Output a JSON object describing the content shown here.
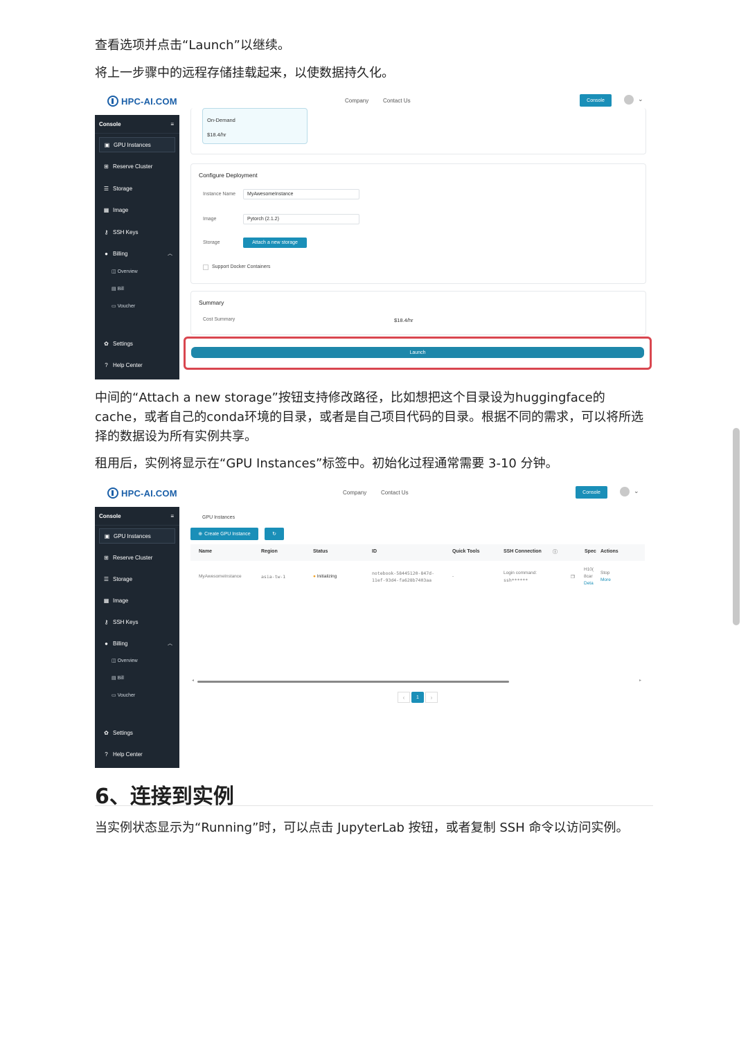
{
  "paragraphs": {
    "p1": "查看选项并点击“Launch”以继续。",
    "p2": "将上一步骤中的远程存储挂载起来，以使数据持久化。",
    "p3": "中间的“Attach a new storage”按钮支持修改路径，比如想把这个目录设为huggingface的cache，或者自己的conda环境的目录，或者是自己项目代码的目录。根据不同的需求，可以将所选择的数据设为所有实例共享。",
    "p4": "租用后，实例将显示在“GPU Instances”标签中。初始化过程通常需要 3-10 分钟。",
    "p5": "当实例状态显示为“Running”时，可以点击 JupyterLab 按钮，或者复制 SSH 命令以访问实例。"
  },
  "section_heading": "6、连接到实例",
  "app": {
    "logo": "HPC-AI.COM",
    "nav": [
      "Company",
      "Contact Us"
    ],
    "console_button": "Console",
    "sidebar": {
      "title": "Console",
      "items": [
        "GPU Instances",
        "Reserve Cluster",
        "Storage",
        "Image",
        "SSH Keys",
        "Billing"
      ],
      "billing_sub": [
        "Overview",
        "Bill",
        "Voucher"
      ],
      "bottom": [
        "Settings",
        "Help Center"
      ]
    }
  },
  "shot1": {
    "plan_name": "On-Demand",
    "plan_price": "$18.4/hr",
    "configure_title": "Configure Deployment",
    "instance_name_label": "Instance Name",
    "instance_name_value": "MyAwesomeInstance",
    "image_label": "Image",
    "image_value": "Pytorch (2.1.2)",
    "storage_label": "Storage",
    "attach_button": "Attach a new storage",
    "docker_checkbox": "Support Docker Containers",
    "summary_title": "Summary",
    "cost_label": "Cost Summary",
    "cost_value": "$18.4/hr",
    "launch_button": "Launch"
  },
  "shot2": {
    "breadcrumb": "GPU Instances",
    "create_button": "Create GPU Instance",
    "columns": [
      "Name",
      "Region",
      "Status",
      "ID",
      "Quick Tools",
      "SSH Connection",
      "Spec",
      "Actions"
    ],
    "row": {
      "name": "MyAwesomeInstance",
      "region": "asia-tw-1",
      "status": "Initializing",
      "id_line1": "notebook-58445120-847d-",
      "id_line2": "11ef-93d4-fa628b7403aa",
      "quick_tools": "-",
      "ssh_line1": "Login command:",
      "ssh_line2": "ssh******",
      "spec_line1": "H10(",
      "spec_line2": "8car",
      "spec_line3": "Deta",
      "action1": "Stop",
      "action2": "More"
    },
    "page": "1"
  }
}
